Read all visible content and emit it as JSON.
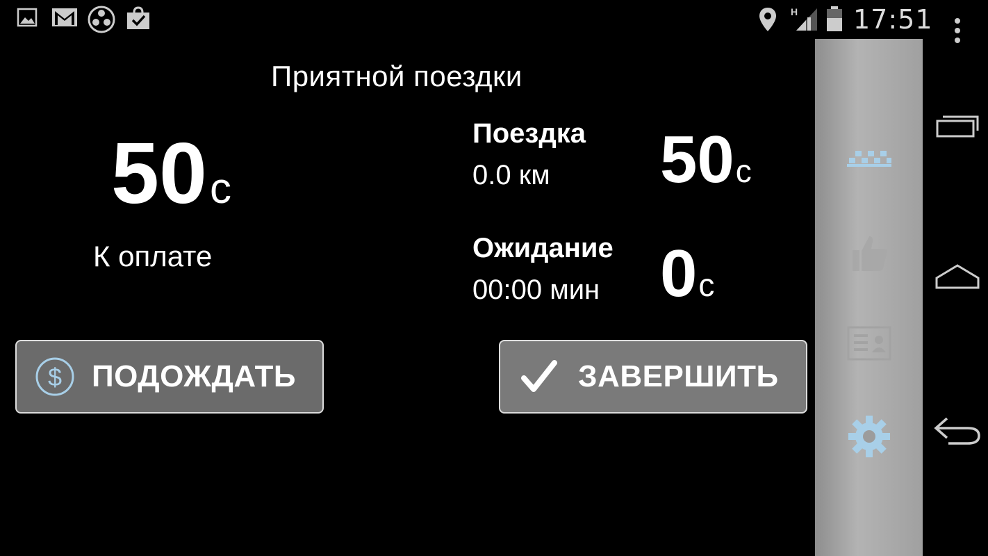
{
  "status_bar": {
    "time": "17:51",
    "left_icons": [
      "image-icon",
      "gmail-icon",
      "film-reel-icon",
      "shopping-bag-icon"
    ],
    "right_icons": [
      "location-pin-icon",
      "signal-icon",
      "battery-icon"
    ],
    "network_type": "H"
  },
  "header": {
    "title": "Приятной поездки"
  },
  "total": {
    "amount": "50",
    "unit": "с",
    "label": "К оплате"
  },
  "trip": {
    "title": "Поездка",
    "distance": "0.0 км",
    "amount": "50",
    "unit": "с"
  },
  "waiting": {
    "title": "Ожидание",
    "time": "00:00 мин",
    "amount": "0",
    "unit": "с"
  },
  "buttons": {
    "wait": {
      "label": "ПОДОЖДАТЬ",
      "icon": "dollar-icon"
    },
    "finish": {
      "label": "ЗАВЕРШИТЬ",
      "icon": "checkmark-icon"
    }
  },
  "drawer": {
    "items": [
      "taxi-checker-icon",
      "thumbs-up-icon",
      "id-card-icon",
      "gear-icon"
    ]
  },
  "colors": {
    "background": "#000000",
    "button_fill": "#6e6e6e",
    "button_fill_finish": "#7c7c7c",
    "drawer": "#a5a5a5",
    "accent_icon": "#a8cfe8"
  }
}
